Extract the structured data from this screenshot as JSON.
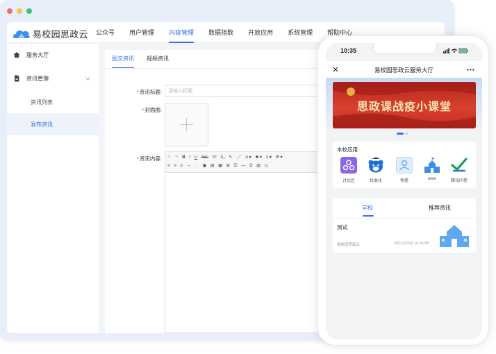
{
  "browser": {
    "dots": [
      "#f26b6b",
      "#f7c646",
      "#3ec470"
    ]
  },
  "app": {
    "title": "易校园思政云",
    "nav": [
      "公众号",
      "用户管理",
      "内容管理",
      "数据指数",
      "开放应用",
      "系统管理",
      "帮助中心"
    ],
    "nav_active": "内容管理"
  },
  "sidebar": {
    "items": [
      {
        "label": "服务大厅",
        "icon": "home-icon"
      },
      {
        "label": "资讯管理",
        "icon": "document-icon",
        "expand_icon": "chevron-down-icon"
      },
      {
        "label": "资讯列表"
      },
      {
        "label": "发布资讯"
      }
    ],
    "selected": "发布资讯"
  },
  "content": {
    "tabs": [
      "图文资讯",
      "视频资讯"
    ],
    "active_tab": "图文资讯",
    "form": {
      "title_label": "资讯标题:",
      "title_placeholder": "请输入标题",
      "cover_label": "封面图:",
      "body_label": "资讯内容:",
      "required_mark": "*"
    },
    "editor_toolbar": {
      "row1": [
        "↶",
        "↷",
        "B",
        "I",
        "U",
        "ABC",
        "X²",
        "X₂",
        "✎",
        "🧹",
        "A ▾",
        "✱ ▾",
        "≡ ▾",
        "☰ ▾"
      ],
      "row2": [
        "≡",
        "≡",
        "≡",
        "⇔",
        "⬚",
        "▣",
        "▤",
        "▦",
        "⊞",
        "☑",
        "—",
        "Ω",
        "▥",
        "▧"
      ]
    }
  },
  "phone": {
    "time": "10:35",
    "header_title": "易校园思政云服务大厅",
    "close_icon": "close-icon",
    "more_icon": "more-icon",
    "banner_text": "思政课战疫小课堂",
    "apps_title": "本校应用",
    "apps": [
      {
        "label": "讨论区",
        "icon": "discussion-icon",
        "color": "#8b66e8"
      },
      {
        "label": "校本化",
        "icon": "bear-icon",
        "color": "#1f6fd6"
      },
      {
        "label": "快搭",
        "icon": "user-card-icon",
        "color": "#7bbcf0"
      },
      {
        "label": "wew",
        "icon": "school-icon",
        "color": "#3d8fe8"
      },
      {
        "label": "腾讯问卷",
        "icon": "check-icon",
        "color": "#1b9d55"
      }
    ],
    "news_tabs": [
      "学校",
      "推荐资讯"
    ],
    "news_active": "学校",
    "news_item": {
      "title": "测试",
      "source": "易校园思政云",
      "date": "2021/12/16 16:16:55"
    }
  }
}
